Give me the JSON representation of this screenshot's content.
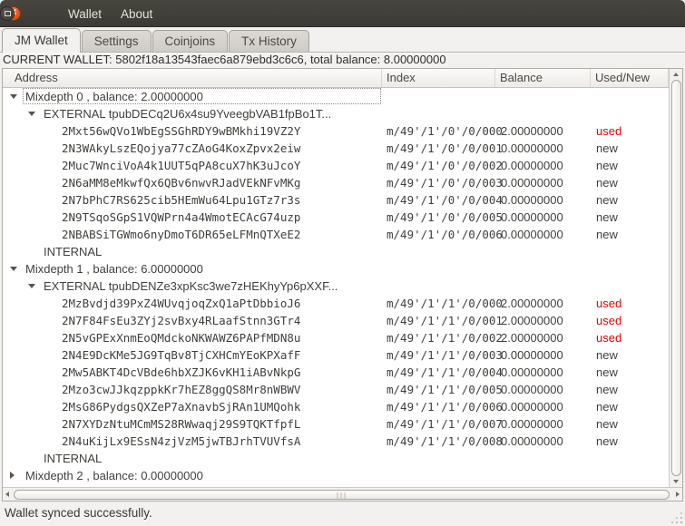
{
  "window": {
    "menu": [
      "Wallet",
      "About"
    ]
  },
  "tabs": [
    {
      "label": "JM Wallet",
      "active": true
    },
    {
      "label": "Settings",
      "active": false
    },
    {
      "label": "Coinjoins",
      "active": false
    },
    {
      "label": "Tx History",
      "active": false
    }
  ],
  "wallet_header": "CURRENT WALLET: 5802f18a13543faec6a879ebd3c6c6, total balance: 8.00000000",
  "columns": [
    "Address",
    "Index",
    "Balance",
    "Used/New"
  ],
  "tree": {
    "rows": [
      {
        "kind": "mixdepth",
        "expander": "open",
        "focused": true,
        "label": "Mixdepth 0 , balance: 2.00000000"
      },
      {
        "kind": "branch",
        "expander": "open",
        "label": "EXTERNAL tpubDECq2U6x4su9YveegbVAB1fpBo1T..."
      },
      {
        "kind": "address",
        "label": "2Mxt56wQVo1WbEgSSGhRDY9wBMkhi19VZ2Y",
        "index": "m/49'/1'/0'/0/000",
        "balance": "2.00000000",
        "status": "used"
      },
      {
        "kind": "address",
        "label": "2N3WAkyLszEQojya77cZAoG4KoxZpvx2eiw",
        "index": "m/49'/1'/0'/0/001",
        "balance": "0.00000000",
        "status": "new"
      },
      {
        "kind": "address",
        "label": "2Muc7WnciVoA4k1UUT5qPA8cuX7hK3uJcoY",
        "index": "m/49'/1'/0'/0/002",
        "balance": "0.00000000",
        "status": "new"
      },
      {
        "kind": "address",
        "label": "2N6aMM8eMkwfQx6QBv6nwvRJadVEkNFvMKg",
        "index": "m/49'/1'/0'/0/003",
        "balance": "0.00000000",
        "status": "new"
      },
      {
        "kind": "address",
        "label": "2N7bPhC7RS625cib5HEmWu64Lpu1GTz7r3s",
        "index": "m/49'/1'/0'/0/004",
        "balance": "0.00000000",
        "status": "new"
      },
      {
        "kind": "address",
        "label": "2N9TSqoSGpS1VQWPrn4a4WmotECAcG74uzp",
        "index": "m/49'/1'/0'/0/005",
        "balance": "0.00000000",
        "status": "new"
      },
      {
        "kind": "address",
        "label": "2NBABSiTGWmo6nyDmoT6DR65eLFMnQTXeE2",
        "index": "m/49'/1'/0'/0/006",
        "balance": "0.00000000",
        "status": "new"
      },
      {
        "kind": "branch",
        "label": "INTERNAL"
      },
      {
        "kind": "mixdepth",
        "expander": "open",
        "label": "Mixdepth 1 , balance: 6.00000000"
      },
      {
        "kind": "branch",
        "expander": "open",
        "label": "EXTERNAL tpubDENZe3xpKsc3we7zHEKhyYp6pXXF..."
      },
      {
        "kind": "address",
        "label": "2MzBvdjd39PxZ4WUvqjoqZxQ1aPtDbbioJ6",
        "index": "m/49'/1'/1'/0/000",
        "balance": "2.00000000",
        "status": "used"
      },
      {
        "kind": "address",
        "label": "2N7F84FsEu3ZYj2svBxy4RLaafStnn3GTr4",
        "index": "m/49'/1'/1'/0/001",
        "balance": "2.00000000",
        "status": "used"
      },
      {
        "kind": "address",
        "label": "2N5vGPExXnmEoQMdckoNKWAWZ6PAPfMDN8u",
        "index": "m/49'/1'/1'/0/002",
        "balance": "2.00000000",
        "status": "used"
      },
      {
        "kind": "address",
        "label": "2N4E9DcKMe5JG9TqBv8TjCXHCmYEoKPXafF",
        "index": "m/49'/1'/1'/0/003",
        "balance": "0.00000000",
        "status": "new"
      },
      {
        "kind": "address",
        "label": "2Mw5ABKT4DcVBde6hbXZJK6vKH1iABvNkpG",
        "index": "m/49'/1'/1'/0/004",
        "balance": "0.00000000",
        "status": "new"
      },
      {
        "kind": "address",
        "label": "2Mzo3cwJJkqzppkKr7hEZ8ggQS8Mr8nWBWV",
        "index": "m/49'/1'/1'/0/005",
        "balance": "0.00000000",
        "status": "new"
      },
      {
        "kind": "address",
        "label": "2MsG86PydgsQXZeP7aXnavbSjRAn1UMQohk",
        "index": "m/49'/1'/1'/0/006",
        "balance": "0.00000000",
        "status": "new"
      },
      {
        "kind": "address",
        "label": "2N7XYDzNtuMCmMS28RWwaqj29S9TQKTfpfL",
        "index": "m/49'/1'/1'/0/007",
        "balance": "0.00000000",
        "status": "new"
      },
      {
        "kind": "address",
        "label": "2N4uKijLx9ESsN4zjVzM5jwTBJrhTVUVfsA",
        "index": "m/49'/1'/1'/0/008",
        "balance": "0.00000000",
        "status": "new"
      },
      {
        "kind": "branch",
        "label": "INTERNAL"
      },
      {
        "kind": "mixdepth",
        "expander": "closed",
        "label": "Mixdepth 2 , balance: 0.00000000"
      }
    ]
  },
  "statusbar": {
    "text": "Wallet synced successfully."
  },
  "colors": {
    "used_text": "#e60000",
    "close_button": "#e3571f",
    "titlebar_bg": "#3b3a35"
  }
}
